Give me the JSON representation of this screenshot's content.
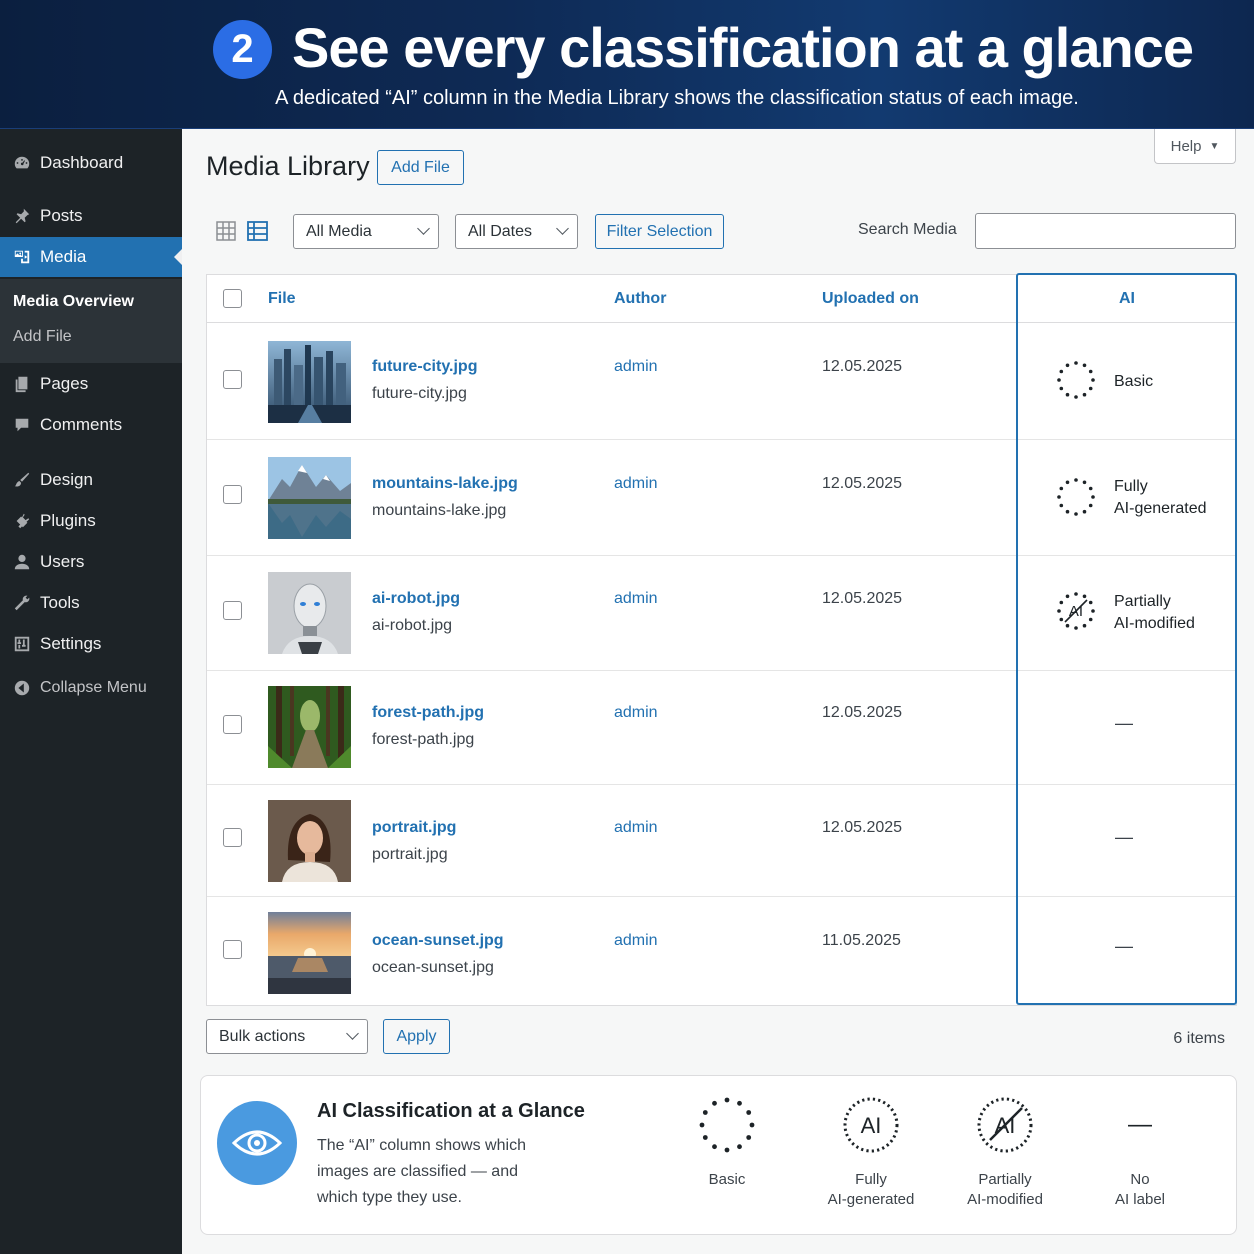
{
  "banner": {
    "step": "2",
    "title": "See every classification at a glance",
    "subtitle": "A dedicated “AI” column in the Media Library shows the classification status of each image."
  },
  "sidebar": {
    "items": [
      {
        "label": "Dashboard",
        "icon": "dashboard-icon"
      },
      {
        "label": "Posts",
        "icon": "pin-icon"
      },
      {
        "label": "Media",
        "icon": "media-icon",
        "active": true
      },
      {
        "label": "Pages",
        "icon": "pages-icon"
      },
      {
        "label": "Comments",
        "icon": "comment-icon"
      },
      {
        "label": "Design",
        "icon": "brush-icon"
      },
      {
        "label": "Plugins",
        "icon": "plug-icon"
      },
      {
        "label": "Users",
        "icon": "user-icon"
      },
      {
        "label": "Tools",
        "icon": "wrench-icon"
      },
      {
        "label": "Settings",
        "icon": "settings-icon"
      }
    ],
    "submenu": {
      "current": "Media Overview",
      "other": "Add File"
    },
    "collapse": "Collapse Menu"
  },
  "header": {
    "help": "Help",
    "title": "Media Library",
    "add_file": "Add File"
  },
  "toolbar": {
    "media_filter": "All Media",
    "date_filter": "All Dates",
    "filter_selection": "Filter Selection",
    "search_label": "Search Media",
    "search_value": ""
  },
  "table": {
    "columns": {
      "file": "File",
      "author": "Author",
      "uploaded": "Uploaded on",
      "ai": "AI"
    },
    "rows": [
      {
        "title": "future-city.jpg",
        "file": "future-city.jpg",
        "author": "admin",
        "date": "12.05.2025",
        "ai": [
          "Basic",
          ""
        ],
        "ai_type": "basic"
      },
      {
        "title": "mountains-lake.jpg",
        "file": "mountains-lake.jpg",
        "author": "admin",
        "date": "12.05.2025",
        "ai": [
          "Fully",
          "AI-generated"
        ],
        "ai_type": "fully"
      },
      {
        "title": "ai-robot.jpg",
        "file": "ai-robot.jpg",
        "author": "admin",
        "date": "12.05.2025",
        "ai": [
          "Partially",
          "AI-modified"
        ],
        "ai_type": "partially"
      },
      {
        "title": "forest-path.jpg",
        "file": "forest-path.jpg",
        "author": "admin",
        "date": "12.05.2025",
        "ai": [
          "—",
          ""
        ],
        "ai_type": "none"
      },
      {
        "title": "portrait.jpg",
        "file": "portrait.jpg",
        "author": "admin",
        "date": "12.05.2025",
        "ai": [
          "—",
          ""
        ],
        "ai_type": "none"
      },
      {
        "title": "ocean-sunset.jpg",
        "file": "ocean-sunset.jpg",
        "author": "admin",
        "date": "11.05.2025",
        "ai": [
          "—",
          ""
        ],
        "ai_type": "none"
      }
    ]
  },
  "footer": {
    "bulk_actions": "Bulk actions",
    "apply": "Apply",
    "items_count": "6 items"
  },
  "legend": {
    "title": "AI Classification at a Glance",
    "description": "The “AI” column shows which images are classified — and which type they use.",
    "items": [
      {
        "line1": "Basic",
        "line2": "",
        "icon": "basic-icon"
      },
      {
        "line1": "Fully",
        "line2": "AI-generated",
        "icon": "ai-fully-icon",
        "icon_text": "AI"
      },
      {
        "line1": "Partially",
        "line2": "AI-modified",
        "icon": "ai-partially-icon",
        "icon_text": "AI"
      },
      {
        "line1": "No",
        "line2": "AI label",
        "icon": "dash-icon",
        "icon_text": "—"
      }
    ]
  },
  "colors": {
    "accent": "#2271b1",
    "sidebar": "#1d2327",
    "banner": "#0e2a55",
    "badge": "#2b6de5"
  }
}
